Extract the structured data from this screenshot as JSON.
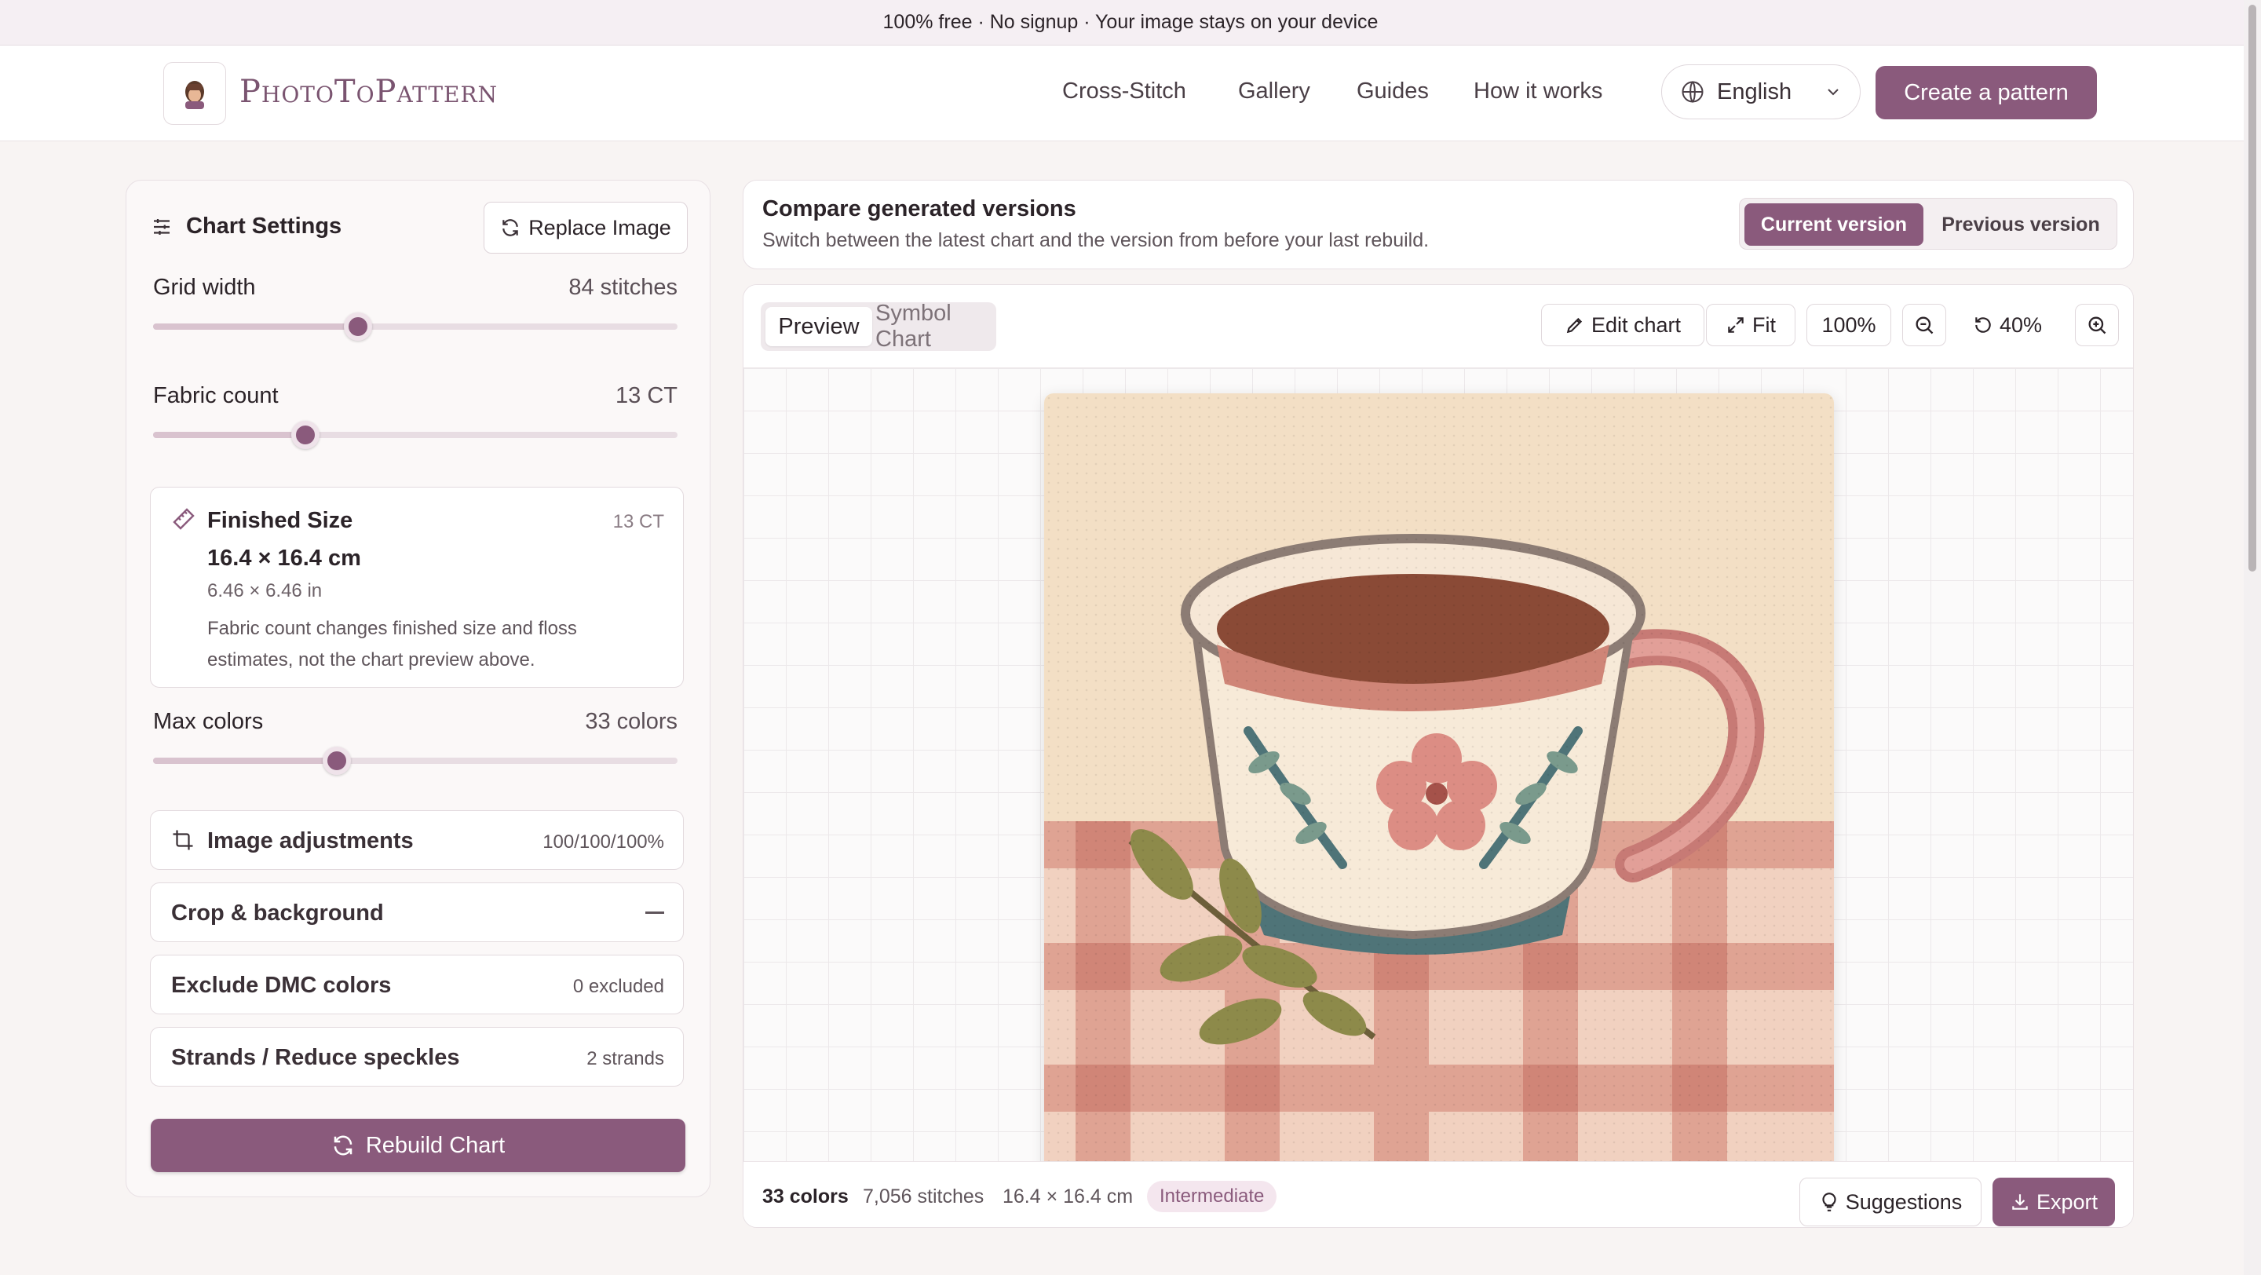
{
  "banner": {
    "text": "100% free · No signup · Your image stays on your device"
  },
  "header": {
    "brand": "PhotoToPattern",
    "nav": [
      "Cross-Stitch",
      "Gallery",
      "Guides",
      "How it works"
    ],
    "language": "English",
    "cta": "Create a pattern"
  },
  "settings": {
    "title": "Chart Settings",
    "replace_label": "Replace Image",
    "grid_width": {
      "label": "Grid width",
      "value": "84 stitches",
      "level": 0.39
    },
    "fabric_count": {
      "label": "Fabric count",
      "value": "13 CT",
      "level": 0.29
    },
    "finished_size": {
      "title": "Finished Size",
      "badge": "13 CT",
      "cm": "16.4 × 16.4 cm",
      "inches": "6.46 × 6.46 in",
      "note": "Fabric count changes finished size and floss estimates, not the chart preview above."
    },
    "max_colors": {
      "label": "Max colors",
      "value": "33 colors",
      "level": 0.35
    },
    "image_adjustments": {
      "label": "Image adjustments",
      "value": "100/100/100%"
    },
    "crop_background": {
      "label": "Crop & background"
    },
    "exclude_dmc": {
      "label": "Exclude DMC colors",
      "value": "0 excluded"
    },
    "strands": {
      "label": "Strands / Reduce speckles",
      "value": "2 strands"
    },
    "rebuild_label": "Rebuild Chart"
  },
  "compare": {
    "title": "Compare generated versions",
    "subtitle": "Switch between the latest chart and the version from before your last rebuild.",
    "current": "Current version",
    "previous": "Previous version"
  },
  "preview": {
    "tab_preview": "Preview",
    "tab_symbol": "Symbol Chart",
    "edit_label": "Edit chart",
    "fit_label": "Fit",
    "zoom_reset": "100%",
    "zoom_level": "40%"
  },
  "footer": {
    "colors": "33 colors",
    "stitches": "7,056 stitches",
    "size": "16.4 × 16.4 cm",
    "level": "Intermediate",
    "suggestions": "Suggestions",
    "export": "Export"
  },
  "colors": {
    "accent": "#8a5a7c",
    "fabric": "#f3dfc5",
    "tea": "#8a4a36",
    "cup_pink": "#d98a82",
    "leaf": "#7b8a52",
    "saucer_blue": "#4f7478"
  }
}
